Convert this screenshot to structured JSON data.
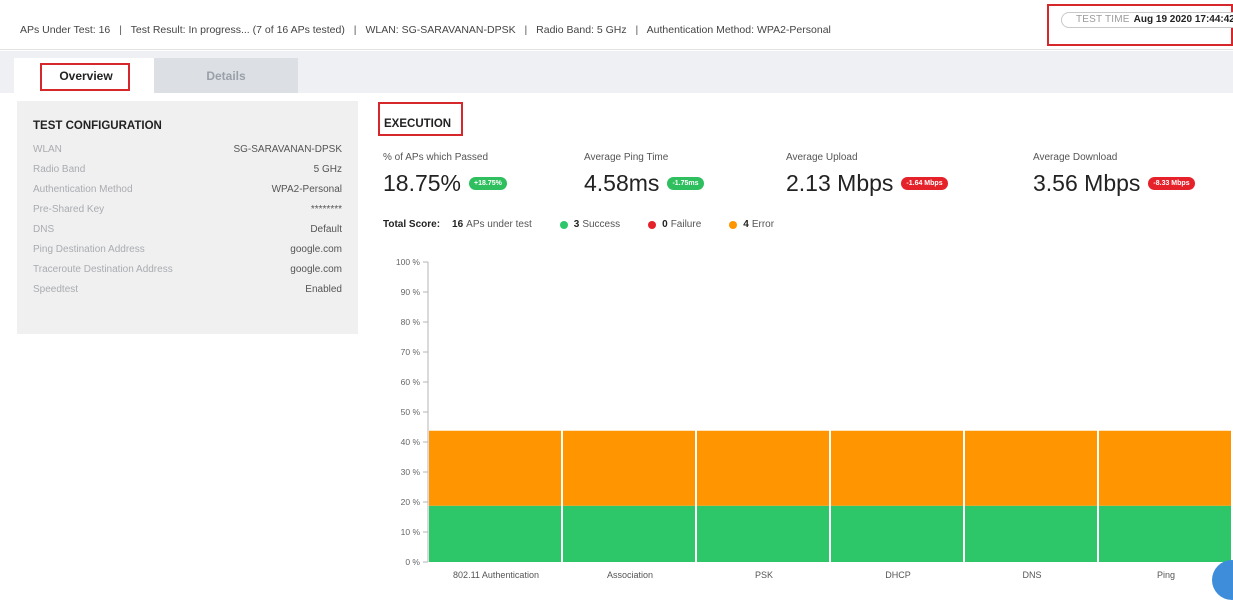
{
  "topbar": {
    "aps_under_test": "APs Under Test: 16",
    "test_result": "Test Result: In progress... (7 of 16 APs tested)",
    "wlan": "WLAN: SG-SARAVANAN-DPSK",
    "radio_band": "Radio Band: 5 GHz",
    "auth_method": "Authentication Method: WPA2-Personal",
    "separator": "|",
    "test_time_label": "TEST TIME",
    "test_time_value": "Aug 19 2020 17:44:42"
  },
  "tabs": {
    "overview": "Overview",
    "details": "Details"
  },
  "config": {
    "title": "TEST CONFIGURATION",
    "rows": [
      {
        "key": "WLAN",
        "value": "SG-SARAVANAN-DPSK"
      },
      {
        "key": "Radio Band",
        "value": "5 GHz"
      },
      {
        "key": "Authentication Method",
        "value": "WPA2-Personal"
      },
      {
        "key": "Pre-Shared Key",
        "value": "********"
      },
      {
        "key": "DNS",
        "value": "Default"
      },
      {
        "key": "Ping Destination Address",
        "value": "google.com"
      },
      {
        "key": "Traceroute Destination Address",
        "value": "google.com"
      },
      {
        "key": "Speedtest",
        "value": "Enabled"
      }
    ]
  },
  "execution": {
    "title": "EXECUTION",
    "metrics": [
      {
        "label": "% of APs which Passed",
        "value": "18.75%",
        "delta": "+18.75%",
        "status": "positive"
      },
      {
        "label": "Average Ping Time",
        "value": "4.58ms",
        "delta": "-1.75ms",
        "status": "positive"
      },
      {
        "label": "Average Upload",
        "value": "2.13 Mbps",
        "delta": "-1.64 Mbps",
        "status": "negative"
      },
      {
        "label": "Average Download",
        "value": "3.56 Mbps",
        "delta": "-8.33 Mbps",
        "status": "negative"
      }
    ],
    "score": {
      "label": "Total Score:",
      "aps_count": "16",
      "aps_text": "APs under test",
      "success_count": "3",
      "success_text": "Success",
      "failure_count": "0",
      "failure_text": "Failure",
      "error_count": "4",
      "error_text": "Error"
    }
  },
  "colors": {
    "success": "#2dc76a",
    "failure": "#e5212a",
    "error": "#ff9500",
    "highlight": "#d6282b"
  },
  "chart_data": {
    "type": "bar",
    "stacked": true,
    "categories": [
      "802.11 Authentication",
      "Association",
      "PSK",
      "DHCP",
      "DNS",
      "Ping"
    ],
    "series": [
      {
        "name": "Success",
        "color": "#2dc76a",
        "values": [
          18.75,
          18.75,
          18.75,
          18.75,
          18.75,
          18.75
        ]
      },
      {
        "name": "Error",
        "color": "#ff9500",
        "values": [
          25,
          25,
          25,
          25,
          25,
          25
        ]
      }
    ],
    "yticks": [
      "0 %",
      "10 %",
      "20 %",
      "30 %",
      "40 %",
      "50 %",
      "60 %",
      "70 %",
      "80 %",
      "90 %",
      "100 %"
    ],
    "ylim": [
      0,
      100
    ]
  }
}
